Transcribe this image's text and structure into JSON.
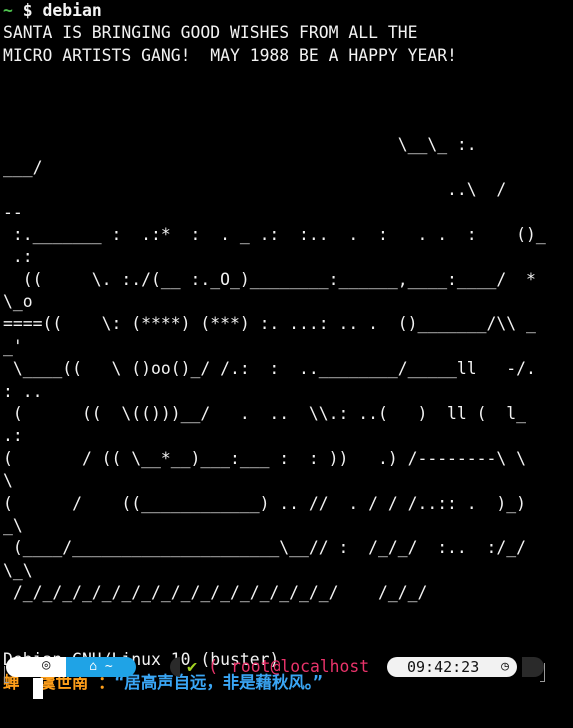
{
  "terminal": {
    "prompt_tilde": "~",
    "prompt_command": " $ debian",
    "lines": [
      "SANTA IS BRINGING GOOD WISHES FROM ALL THE",
      "MICRO ARTISTS GANG!  MAY 1988 BE A HAPPY YEAR!",
      "",
      "",
      "",
      "                                        \\__\\_ :.",
      "___/",
      "                                             ..\\  /",
      "--",
      " :._______ :  .:*  :  . _ .:  :..  .  :   . .  :    ()_",
      " .:",
      "  ((     \\. :./(__ :._O_)________:______,____:____/  *",
      "\\_o",
      "====((    \\: (****) (***) :. ...: .. .  ()_______/\\\\ _",
      "_'",
      " \\____((   \\ ()oo()_/ /.:  :  ..________/_____ll   -/.",
      ": ..",
      " (      ((  \\(()))__/   .  ..  \\\\.: ..(   )  ll (  l_",
      ".:",
      "(       / (( \\__*__)___:___ :  : ))   .) /--------\\ \\",
      "\\",
      "(      /    ((____________) .. //  . / / /..:: .  )_)",
      "_\\",
      " (____/_____________________\\__// :  /_/_/  :..  :/_/",
      "\\_\\",
      " /_/_/_/_/_/_/_/_/_/_/_/_/_/_/_/_/    /_/_/",
      "",
      "",
      "Debian GNU/Linux 10 (buster)"
    ],
    "quote_author": "蝉  虞世南 ：",
    "quote_text": "“居高声自远，非是藉秋风。”"
  },
  "statusbar": {
    "debian_icon": "◎",
    "home_label": "⌂ ~",
    "check_icon": "✔",
    "paren": "(",
    "user_host": "root@localhost",
    "time": "09:42:23",
    "clock_icon": "◷"
  },
  "colors": {
    "background": "#000000",
    "foreground": "#f2f2f2",
    "prompt_green": "#4fc34f",
    "author_orange": "#ff9f1a",
    "quote_blue": "#3aa6f5",
    "home_segment_blue": "#1fa3e6",
    "check_green": "#a3d322",
    "user_magenta": "#e8336a"
  }
}
